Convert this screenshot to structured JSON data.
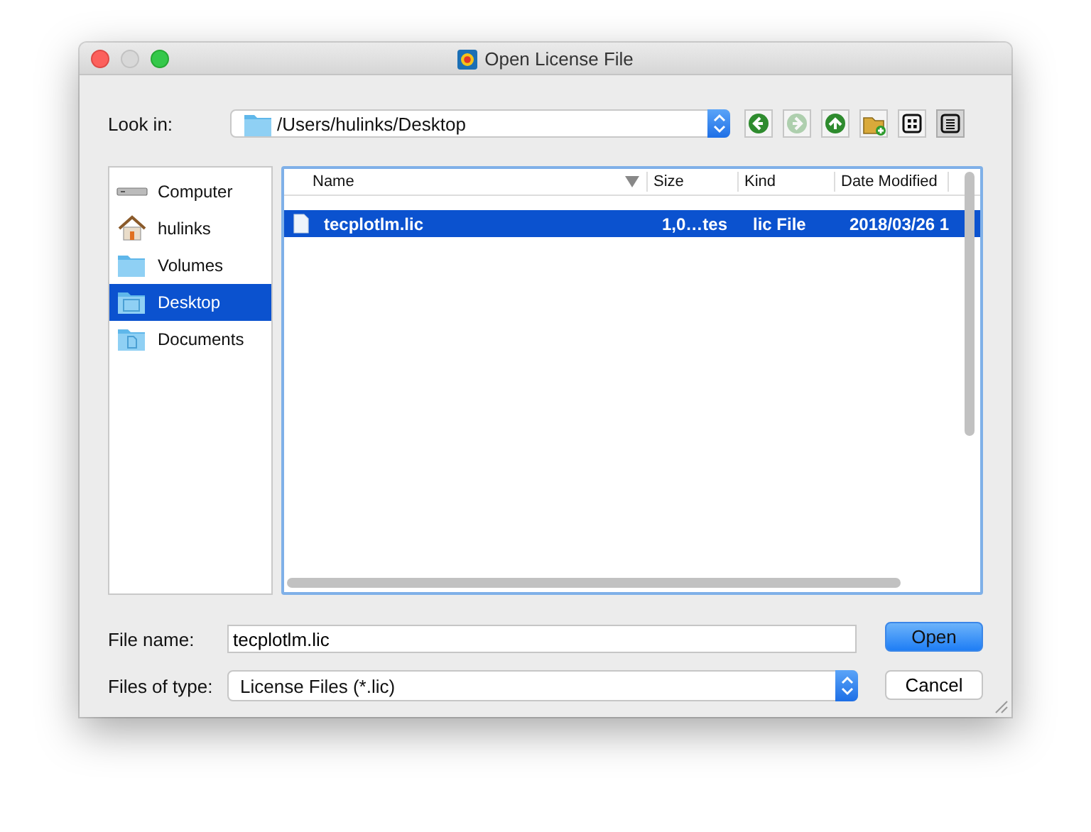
{
  "window": {
    "title": "Open License File"
  },
  "look_in": {
    "label": "Look in:",
    "value": "/Users/hulinks/Desktop"
  },
  "toolbar": [
    {
      "kind": "back",
      "disabled": false
    },
    {
      "kind": "forward",
      "disabled": true
    },
    {
      "kind": "up",
      "disabled": false
    },
    {
      "kind": "newfolder",
      "disabled": false
    },
    {
      "kind": "listview",
      "selected": false
    },
    {
      "kind": "detailview",
      "selected": true
    }
  ],
  "sidebar": {
    "items": [
      {
        "label": "Computer",
        "kind": "computer",
        "selected": false
      },
      {
        "label": "hulinks",
        "kind": "home",
        "selected": false
      },
      {
        "label": "Volumes",
        "kind": "folder",
        "selected": false
      },
      {
        "label": "Desktop",
        "kind": "desktop",
        "selected": true
      },
      {
        "label": "Documents",
        "kind": "documents",
        "selected": false
      }
    ]
  },
  "table": {
    "columns": [
      "Name",
      "Size",
      "Kind",
      "Date Modified"
    ],
    "rows": [
      {
        "cells": [
          "tecplotlm.lic",
          "1,0…tes",
          "lic File",
          "2018/03/26 1"
        ],
        "selected": true
      }
    ]
  },
  "file_name": {
    "label": "File name:",
    "value": "tecplotlm.lic"
  },
  "file_type": {
    "label": "Files of type:",
    "value": "License Files (*.lic)"
  },
  "buttons": [
    {
      "label": "Open",
      "kind": "default"
    },
    {
      "label": "Cancel",
      "kind": "normal"
    }
  ]
}
